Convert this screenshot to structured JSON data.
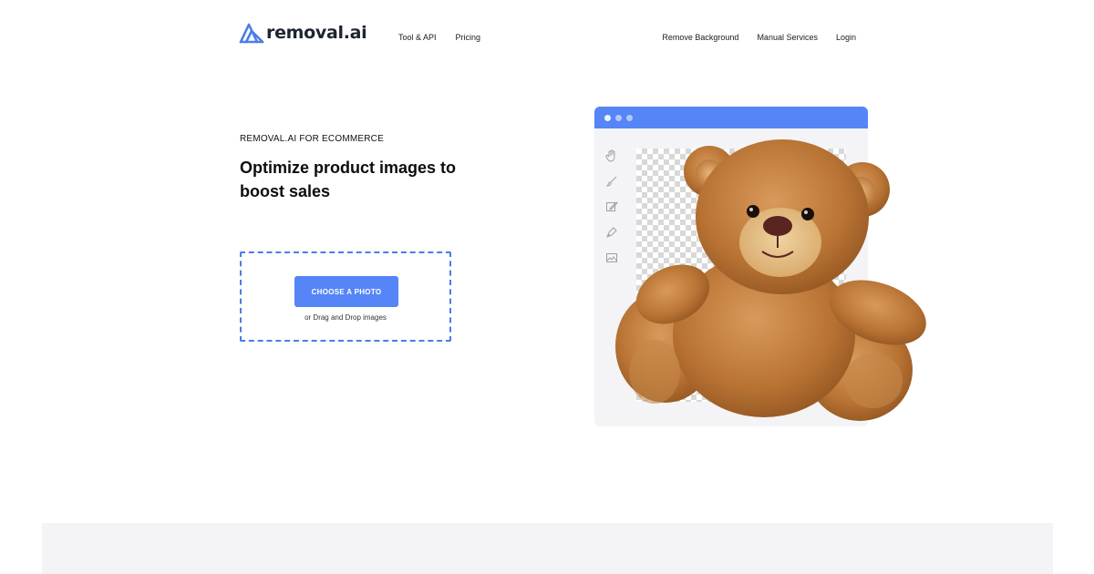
{
  "header": {
    "logo_text": "removal.ai",
    "nav_left": [
      {
        "label": "Tool & API"
      },
      {
        "label": "Pricing"
      }
    ],
    "nav_right": [
      {
        "label": "Remove Background"
      },
      {
        "label": "Manual Services"
      },
      {
        "label": "Login"
      }
    ]
  },
  "hero": {
    "eyebrow": "REMOVAL.AI FOR ECOMMERCE",
    "headline": "Optimize product images to boost sales",
    "upload": {
      "button_label": "CHOOSE A PHOTO",
      "hint": "or Drag and Drop images"
    }
  },
  "illustration": {
    "subject": "teddy bear",
    "tools": [
      "hand-icon",
      "brush-icon",
      "edit-icon",
      "pen-icon",
      "image-icon"
    ]
  },
  "colors": {
    "accent": "#5585f6",
    "dashed_border": "#4a7de8",
    "panel_bg": "#f4f4f6",
    "text_dark": "#111111"
  }
}
